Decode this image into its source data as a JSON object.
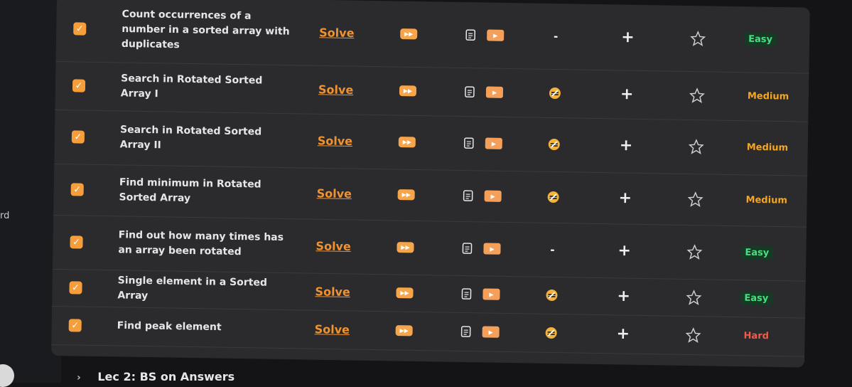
{
  "sidebar": {
    "partial_text": "rd"
  },
  "problems": [
    {
      "title": "Count occurrences of a number in a sorted array with duplicates",
      "solve": "Solve",
      "note": "-",
      "difficulty": "Easy"
    },
    {
      "title": "Search in Rotated Sorted Array I",
      "solve": "Solve",
      "note": "icon",
      "difficulty": "Medium"
    },
    {
      "title": "Search in Rotated Sorted Array II",
      "solve": "Solve",
      "note": "icon",
      "difficulty": "Medium"
    },
    {
      "title": "Find minimum in Rotated Sorted Array",
      "solve": "Solve",
      "note": "icon",
      "difficulty": "Medium"
    },
    {
      "title": "Find out how many times has an array been rotated",
      "solve": "Solve",
      "note": "-",
      "difficulty": "Easy"
    },
    {
      "title": "Single element in a Sorted Array",
      "solve": "Solve",
      "note": "icon",
      "difficulty": "Easy"
    },
    {
      "title": "Find peak element",
      "solve": "Solve",
      "note": "icon",
      "difficulty": "Hard"
    }
  ],
  "revision_symbol": "+",
  "next_section": {
    "label": "Lec 2: BS on Answers"
  },
  "icons": {
    "check": "check-icon",
    "youtube": "youtube-icon",
    "article": "article-icon",
    "video": "video-icon",
    "star": "star-icon",
    "note": "note-icon"
  }
}
